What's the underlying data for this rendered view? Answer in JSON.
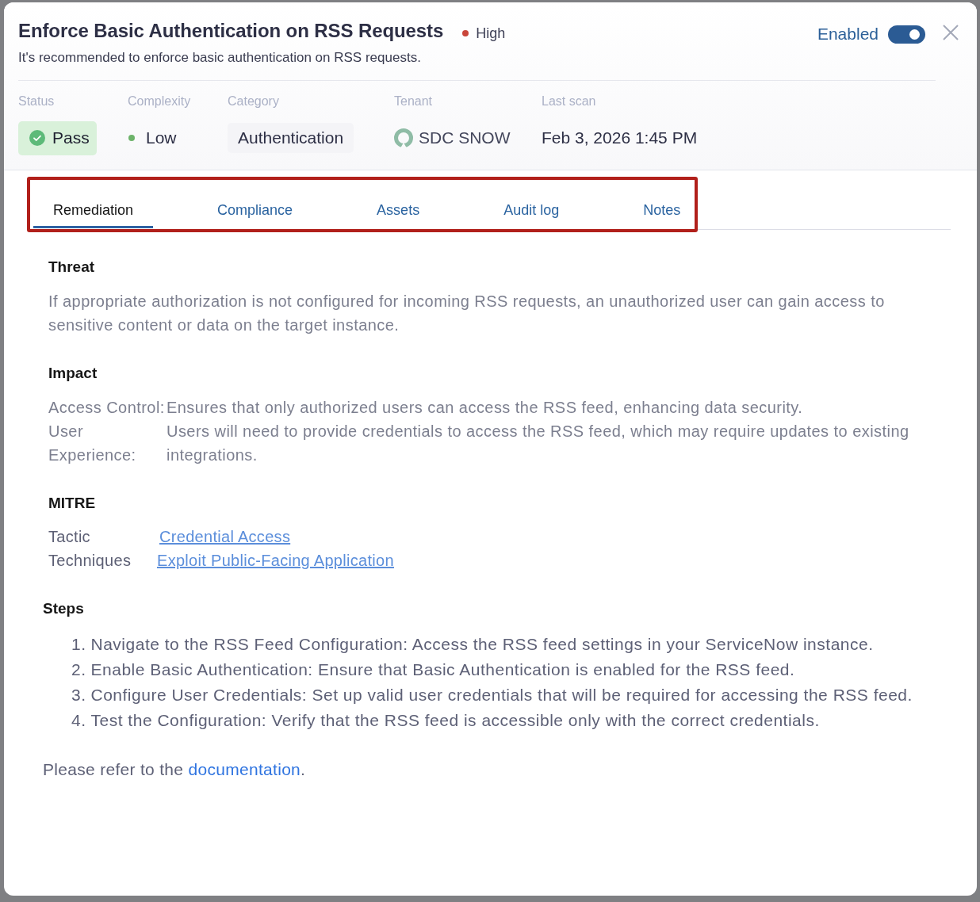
{
  "dialog": {
    "title": "Enforce Basic Authentication on RSS Requests",
    "severity": {
      "label": "High",
      "kind": "high"
    },
    "subtitle": "It's recommended to enforce basic authentication on RSS requests.",
    "enabled_toggle": {
      "label": "Enabled",
      "on": true
    }
  },
  "meta": [
    {
      "kind": "status",
      "label": "Status",
      "value": "Pass",
      "passed": true
    },
    {
      "kind": "rating",
      "label": "Complexity",
      "value": "Low",
      "color": "#6db36a"
    },
    {
      "kind": "tag",
      "label": "Category",
      "value": "Authentication"
    },
    {
      "kind": "tenant",
      "label": "Tenant",
      "value": "SDC SNOW"
    },
    {
      "kind": "text",
      "label": "Last scan",
      "value": "Feb 3, 2026 1:45 PM"
    }
  ],
  "tabs": {
    "highlighted": true,
    "items": [
      {
        "label": "Remediation",
        "selected": true
      },
      {
        "label": "Compliance",
        "selected": false
      },
      {
        "label": "Assets",
        "selected": false
      },
      {
        "label": "Audit log",
        "selected": false
      },
      {
        "label": "Notes",
        "selected": false
      }
    ]
  },
  "threat": {
    "heading": "Threat",
    "text": "If appropriate authorization is not configured for incoming RSS requests, an unauthorized user can gain access to sensitive content or data on the target instance."
  },
  "impact": {
    "heading": "Impact",
    "rows": [
      {
        "label": "Access Control:",
        "text": "Ensures that only authorized users can access the RSS feed, enhancing data security."
      },
      {
        "label": "User Experience:",
        "text": "Users will need to provide credentials to access the RSS feed, which may require updates to existing integrations."
      }
    ]
  },
  "mitre": {
    "heading": "MITRE",
    "rows": [
      {
        "label": "Tactic",
        "link": "Credential Access"
      },
      {
        "label": "Techniques",
        "link": "Exploit Public-Facing Application"
      }
    ]
  },
  "steps": {
    "heading": "Steps",
    "items": [
      {
        "number": "1.",
        "text": "Navigate to the RSS Feed Configuration: Access the RSS feed settings in your ServiceNow instance."
      },
      {
        "number": "2.",
        "text": "Enable Basic Authentication: Ensure that Basic Authentication is enabled for the RSS feed."
      },
      {
        "number": "3.",
        "text": "Configure User Credentials: Set up valid user credentials that will be required for accessing the RSS feed."
      },
      {
        "number": "4.",
        "text": "Test the Configuration: Verify that the RSS feed is accessible only with the correct credentials."
      }
    ]
  },
  "reference": {
    "text_before": "Please refer to the ",
    "link": "documentation",
    "text_after": "."
  }
}
